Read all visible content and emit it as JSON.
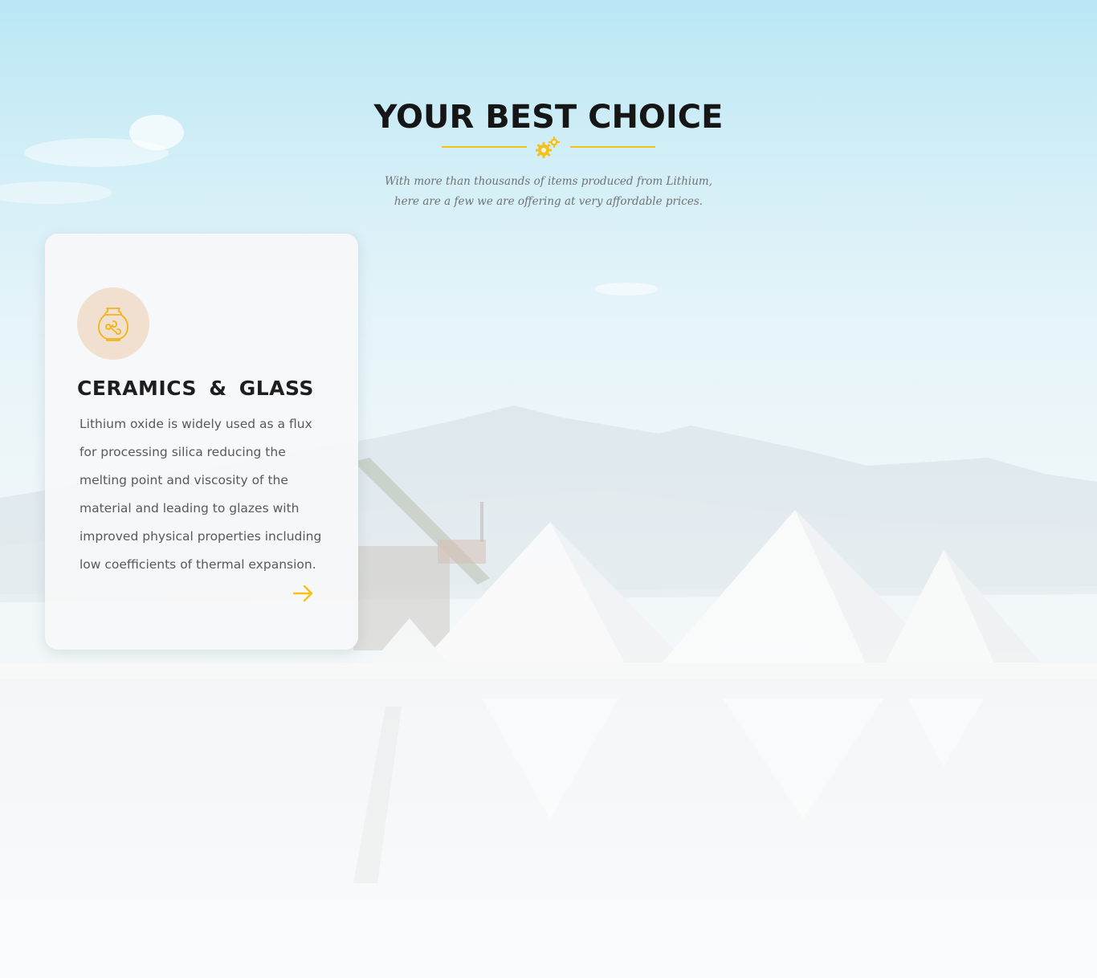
{
  "section": {
    "title": "YOUR BEST CHOICE",
    "subtitle": "With more than thousands of items produced from Lithium, here are a few we are offering at very affordable prices."
  },
  "card": {
    "icon": "vase-icon",
    "title": "CERAMICS & GLASS",
    "text": "Lithium oxide is widely used as a flux for processing silica reducing the melting point and viscosity of the material and leading to glazes with improved physical properties including low coefficients of thermal expansion.",
    "arrow_icon": "arrow-right-icon"
  },
  "colors": {
    "accent": "#f2c21a",
    "title": "#161616",
    "icon_bg": "#f1e0d0"
  }
}
